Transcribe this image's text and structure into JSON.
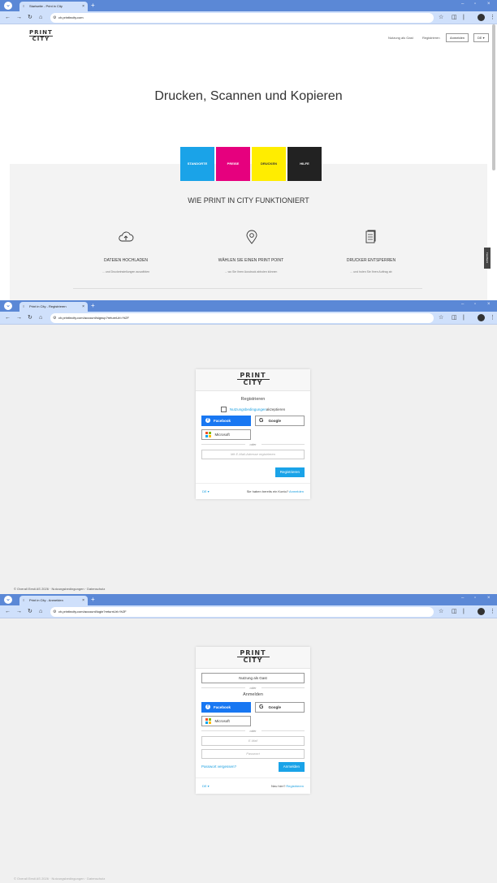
{
  "screen1": {
    "tab_title": "Startseite - Print in City",
    "url": "ch.printincity.com",
    "header": {
      "guest": "Nutzung als Gast",
      "register": "Registrieren",
      "login": "Anmelden",
      "lang": "DE ▾"
    },
    "logo_top": "PRINT",
    "logo_bottom": "CITY",
    "hero_title": "Drucken, Scannen und Kopieren",
    "tiles": [
      {
        "label": "STANDORTE",
        "color": "#1aa3e8"
      },
      {
        "label": "PREISE",
        "color": "#e6007e"
      },
      {
        "label": "DRUCKEN",
        "color": "#ffed00"
      },
      {
        "label": "HILFE",
        "color": "#222222"
      }
    ],
    "howto_title": "WIE PRINT IN CITY FUNKTIONIERT",
    "steps": [
      {
        "title": "DATEIEN HOCHLADEN",
        "desc": "... und Druckeinstellungen auswählen",
        "icon": "cloud-upload-icon"
      },
      {
        "title": "WÄHLEN SIE EINEN PRINT POINT",
        "desc": "... wo Sie Ihren Ausdruck abholen können",
        "icon": "map-pin-icon"
      },
      {
        "title": "DRUCKER ENTSPERREN",
        "desc": "... und holen Sie Ihren Auftrag ab",
        "icon": "document-icon"
      }
    ],
    "feedback": "Feedback"
  },
  "screen2": {
    "tab_title": "Print in City - Registrieren",
    "url": "ch.printincity.com/account/signup?returnUrl=%2F",
    "logo_top": "PRINT",
    "logo_bottom": "CITY",
    "title": "Registrieren",
    "terms_link": "Nutzungsbedingungen",
    "terms_text": " akzeptieren",
    "facebook": "Facebook",
    "google": "Google",
    "microsoft": "Microsoft",
    "or": "oder",
    "email_placeholder": "Mit E-Mail-Adresse registrieren",
    "submit": "Registrieren",
    "lang": "DE ▾",
    "have_account": "Sie haben bereits ein Konto? ",
    "login_link": "Anmelden",
    "footer": "© Overall Eesti AS 2026 · Nutzungsbedingungen · Datenschutz"
  },
  "screen3": {
    "tab_title": "Print in City - Anmelden",
    "url": "ch.printincity.com/account/login?returnUrl=%2F",
    "logo_top": "PRINT",
    "logo_bottom": "CITY",
    "guest": "Nutzung als Gast",
    "or": "oder",
    "title": "Anmelden",
    "facebook": "Facebook",
    "google": "Google",
    "microsoft": "Microsoft",
    "or2": "oder",
    "email_placeholder": "E-Mail",
    "password_placeholder": "Passwort",
    "forgot": "Passwort vergessen?",
    "submit": "Anmelden",
    "lang": "DE ▾",
    "new_here": "Neu hier? ",
    "register_link": "Registrieren",
    "footer": "© Overall Eesti AS 2026 · Nutzungsbedingungen · Datenschutz"
  }
}
